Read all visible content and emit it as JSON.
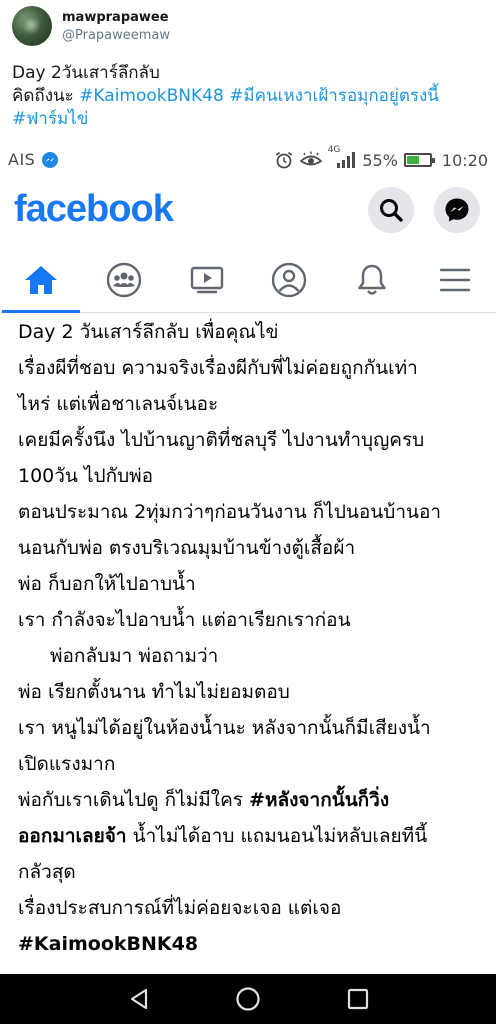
{
  "tweet": {
    "display_name": "mawprapawee",
    "handle": "@Prapaweemaw",
    "line1": "Day 2วันเสาร์ลึกลับ",
    "line2_prefix": "คิดถึงนะ ",
    "hashtag1": "#KaimookBNK48",
    "line2_space": " ",
    "hashtag2": "#มีคนเหงาเฝ้ารอมุกอยู่ตรงนี้",
    "hashtag3": "#ฟาร์มไข่"
  },
  "status_bar": {
    "carrier": "AIS",
    "network": "4G",
    "battery": "55%",
    "battery_level": 0.55,
    "time": "10:20"
  },
  "facebook": {
    "logo_text": "facebook",
    "brand_color": "#1877f2",
    "icons": {
      "search": "search-icon",
      "messenger": "messenger-icon"
    },
    "nav_tabs": [
      {
        "name": "home",
        "icon": "home-icon",
        "active": true
      },
      {
        "name": "groups",
        "icon": "groups-icon",
        "active": false
      },
      {
        "name": "watch",
        "icon": "watch-icon",
        "active": false
      },
      {
        "name": "profile",
        "icon": "profile-icon",
        "active": false
      },
      {
        "name": "notifications",
        "icon": "bell-icon",
        "active": false
      },
      {
        "name": "menu",
        "icon": "hamburger-menu-icon",
        "active": false
      }
    ]
  },
  "post": {
    "lines": [
      "Day 2 วันเสาร์ลึกลับ เพื่อคุณไข่",
      "เรื่องผีที่ชอบ ความจริงเรื่องผีกับพี่ไม่ค่อยถูกกันเท่า",
      "ไหร่ แต่เพื่อชาเลนจ์เนอะ",
      "เคยมีครั้งนึง ไปบ้านญาติที่ชลบุรี ไปงานทำบุญครบ",
      "100วัน ไปกับพ่อ",
      "ตอนประมาณ 2ทุ่มกว่าๆก่อนวันงาน ก็ไปนอนบ้านอา",
      "นอนกับพ่อ ตรงบริเวณมุมบ้านข้างตู้เสื้อผ้า",
      "พ่อ ก็บอกให้ไปอาบน้ำ",
      "เรา กำลังจะไปอาบน้ำ แต่อาเรียกเราก่อน",
      "พ่อกลับมา พ่อถามว่า",
      "พ่อ เรียกตั้งนาน ทำไมไม่ยอมตอบ",
      "เรา หนูไม่ได้อยู่ในห้องน้ำนะ หลังจากนั้นก็มีเสียงน้ำ",
      "เปิดแรงมาก"
    ],
    "line14_normal": "พ่อกับเราเดินไปดู ก็ไม่มีใคร ",
    "line14_bold": "#หลังจากนั้นก็วิ่ง",
    "line15_bold": "ออกมาเลยจ้า",
    "line15_normal": " น้ำไม่ได้อาบ แถมนอนไม่หลับเลยทีนี้",
    "lines_after": [
      "กลัวสุด",
      "เรื่องประสบการณ์ที่ไม่ค่อยจะเจอ แต่เจอ"
    ],
    "hashtag_line": "#KaimookBNK48"
  },
  "android_nav": {
    "back": "back-icon",
    "home": "home-circle-icon",
    "recents": "recents-icon"
  }
}
